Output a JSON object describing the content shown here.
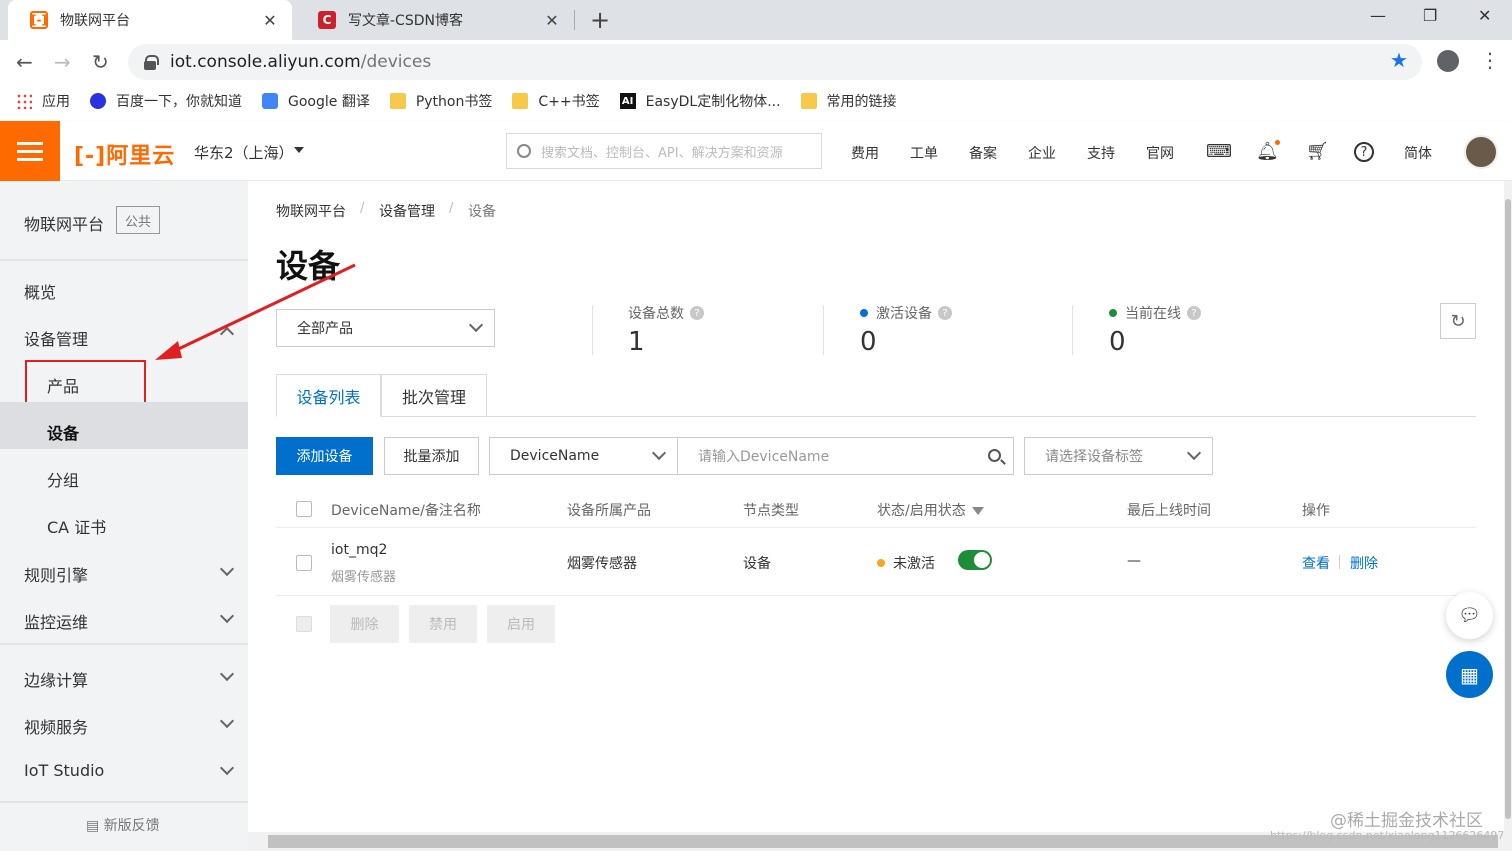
{
  "browser": {
    "tabs": [
      {
        "title": "物联网平台",
        "active": true
      },
      {
        "title": "写文章-CSDN博客",
        "active": false
      }
    ],
    "close_glyph": "✕",
    "new_tab_glyph": "+",
    "window_controls": [
      "—",
      "❐",
      "✕"
    ],
    "url_host": "iot.console.aliyun.com",
    "url_path": "/devices",
    "bookmarks": [
      {
        "label": "应用",
        "icon": "apps-icon"
      },
      {
        "label": "百度一下，你就知道",
        "icon": "baidu-icon"
      },
      {
        "label": "Google 翻译",
        "icon": "google-translate-icon"
      },
      {
        "label": "Python书签",
        "icon": "folder-icon"
      },
      {
        "label": "C++书签",
        "icon": "folder-icon"
      },
      {
        "label": "EasyDL定制化物体...",
        "icon": "ai-icon"
      },
      {
        "label": "常用的链接",
        "icon": "folder-icon"
      }
    ]
  },
  "topbar": {
    "logo": "[-]阿里云",
    "region": "华东2（上海）",
    "search_placeholder": "搜索文档、控制台、API、解决方案和资源",
    "nav": [
      "费用",
      "工单",
      "备案",
      "企业",
      "支持",
      "官网"
    ],
    "lang": "简体",
    "accent_color": "#ff6a00"
  },
  "sidebar": {
    "title": "物联网平台",
    "badge": "公共",
    "items": [
      {
        "label": "概览"
      },
      {
        "label": "设备管理",
        "expanded": true,
        "children": [
          {
            "label": "产品",
            "highlighted": true
          },
          {
            "label": "设备",
            "active": true
          },
          {
            "label": "分组"
          },
          {
            "label": "CA 证书"
          }
        ]
      },
      {
        "label": "规则引擎"
      },
      {
        "label": "监控运维"
      },
      {
        "label": "边缘计算"
      },
      {
        "label": "视频服务"
      },
      {
        "label": "IoT Studio"
      }
    ],
    "feedback": "新版反馈"
  },
  "main": {
    "breadcrumb": [
      "物联网平台",
      "设备管理",
      "设备"
    ],
    "breadcrumb_sep": "/",
    "title": "设备",
    "product_select": "全部产品",
    "stats": [
      {
        "label": "设备总数",
        "value": "1",
        "dot_color": ""
      },
      {
        "label": "激活设备",
        "value": "0",
        "dot_color": "#0070cc"
      },
      {
        "label": "当前在线",
        "value": "0",
        "dot_color": "#1f8c3a"
      }
    ],
    "tabs": [
      {
        "label": "设备列表",
        "active": true
      },
      {
        "label": "批次管理",
        "active": false
      }
    ],
    "toolbar": {
      "add_label": "添加设备",
      "batch_add_label": "批量添加",
      "field_select": "DeviceName",
      "search_placeholder": "请输入DeviceName",
      "tag_placeholder": "请选择设备标签"
    },
    "table": {
      "columns": [
        "DeviceName/备注名称",
        "设备所属产品",
        "节点类型",
        "状态/启用状态",
        "最后上线时间",
        "操作"
      ],
      "rows": [
        {
          "device_name": "iot_mq2",
          "remark": "烟雾传感器",
          "product": "烟雾传感器",
          "node_type": "设备",
          "status": "未激活",
          "status_color": "#f5a623",
          "enabled": true,
          "last_online": "—",
          "actions": [
            "查看",
            "删除"
          ]
        }
      ]
    },
    "bulk_actions": [
      "删除",
      "禁用",
      "启用"
    ]
  },
  "watermark": "@稀土掘金技术社区",
  "watermark_url": "https://blog.csdn.net/xiaolong1126626497"
}
